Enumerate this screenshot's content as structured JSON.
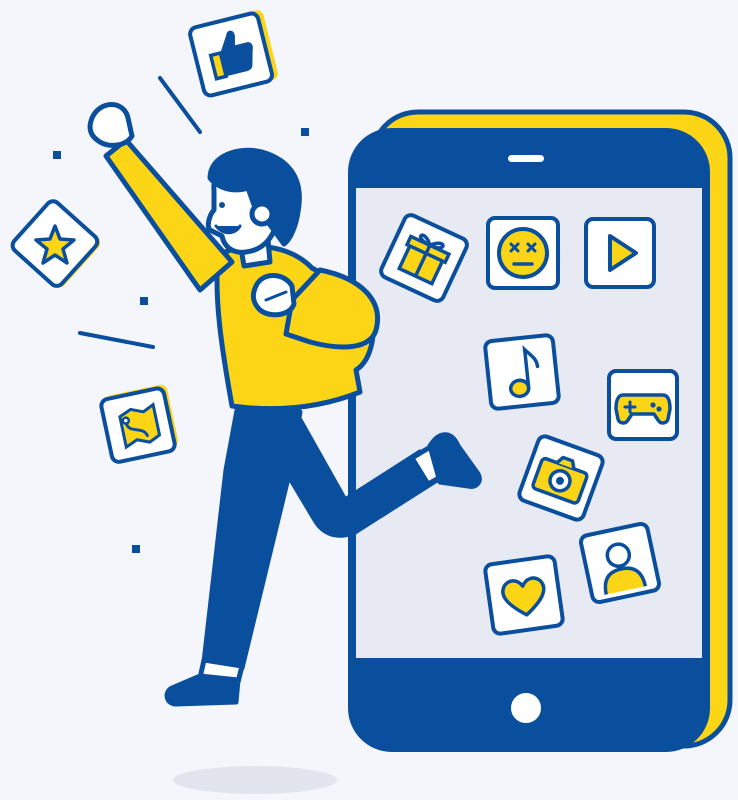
{
  "scene": {
    "description_icons": [
      "thumbs-up-icon",
      "star-icon",
      "map-icon",
      "gift-icon",
      "emoji-face-icon",
      "play-icon",
      "music-note-icon",
      "gamepad-icon",
      "camera-icon",
      "heart-icon",
      "user-icon",
      "home-button"
    ],
    "colors": {
      "background": "#f5f6fb",
      "navy": "#0a4f9e",
      "yellow": "#fcd616",
      "screen": "#e7e9f3",
      "white": "#ffffff",
      "skin": "#ffffff",
      "shadow": "#e3e5ee"
    }
  }
}
